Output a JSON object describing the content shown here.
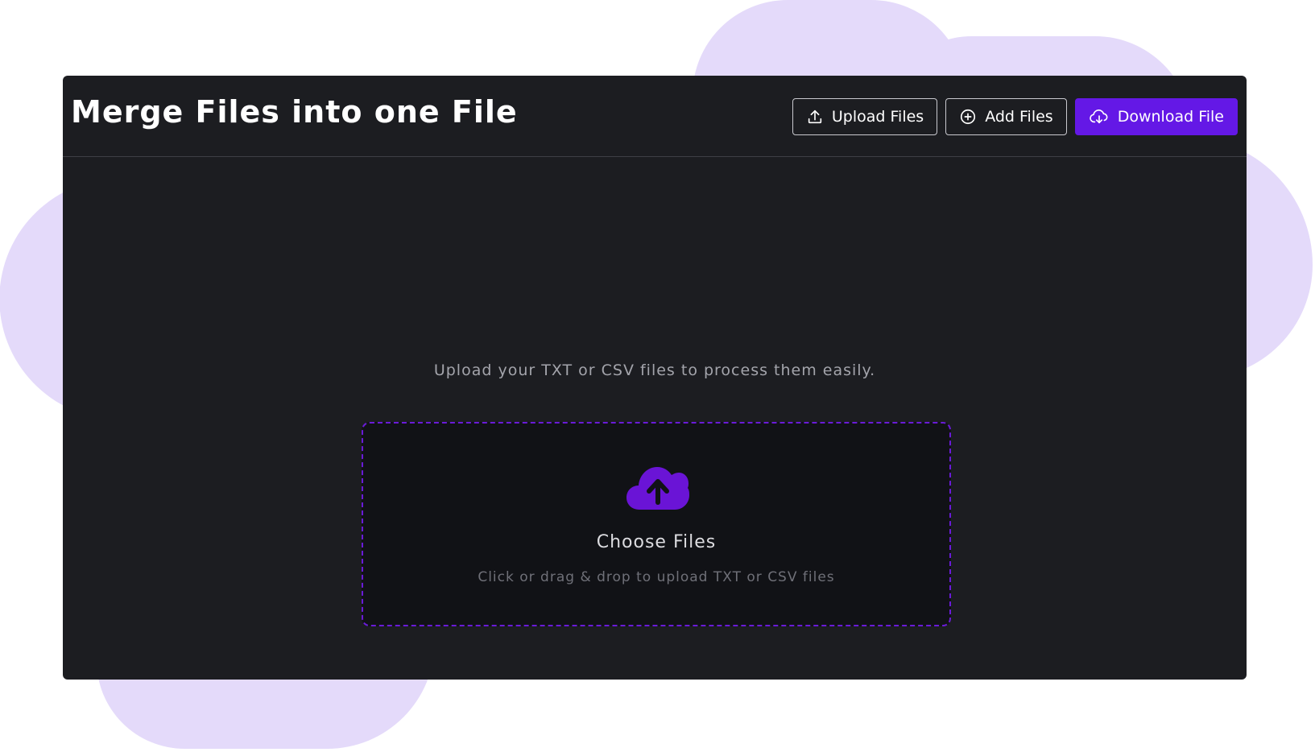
{
  "header": {
    "title": "Merge Files into one File"
  },
  "toolbar": {
    "upload_label": "Upload Files",
    "upload_icon": "upload-icon",
    "add_label": "Add Files",
    "add_icon": "plus-circle-icon",
    "download_label": "Download File",
    "download_icon": "cloud-download-icon"
  },
  "main": {
    "intro": "Upload your TXT or CSV files to process them easily.",
    "dropzone": {
      "icon": "cloud-upload-icon",
      "title": "Choose Files",
      "hint": "Click or drag & drop to upload TXT or CSV files"
    }
  },
  "colors": {
    "accent": "#6418e6",
    "card_background": "#1c1d21",
    "blob": "#e4dafa"
  }
}
